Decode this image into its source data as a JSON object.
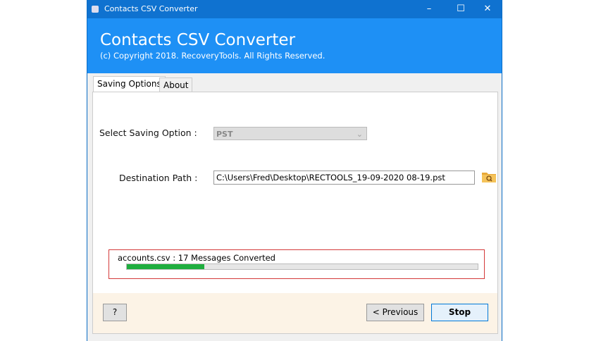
{
  "window": {
    "title": "Contacts CSV Converter",
    "minimize": "–",
    "maximize": "☐",
    "close": "✕"
  },
  "header": {
    "title": "Contacts CSV Converter",
    "copyright": "(c) Copyright 2018. RecoveryTools. All Rights Reserved."
  },
  "tabs": [
    {
      "label": "Saving Options"
    },
    {
      "label": "About"
    }
  ],
  "form": {
    "saving_option_label": "Select Saving Option :",
    "saving_option_value": "PST",
    "destination_label": "Destination Path :",
    "destination_value": "C:\\Users\\Fred\\Desktop\\RECTOOLS_19-09-2020 08-19.pst"
  },
  "progress": {
    "status": "accounts.csv : 17 Messages Converted",
    "fraction": 0.22
  },
  "buttons": {
    "help": "?",
    "previous": "<  Previous",
    "stop": "Stop"
  }
}
